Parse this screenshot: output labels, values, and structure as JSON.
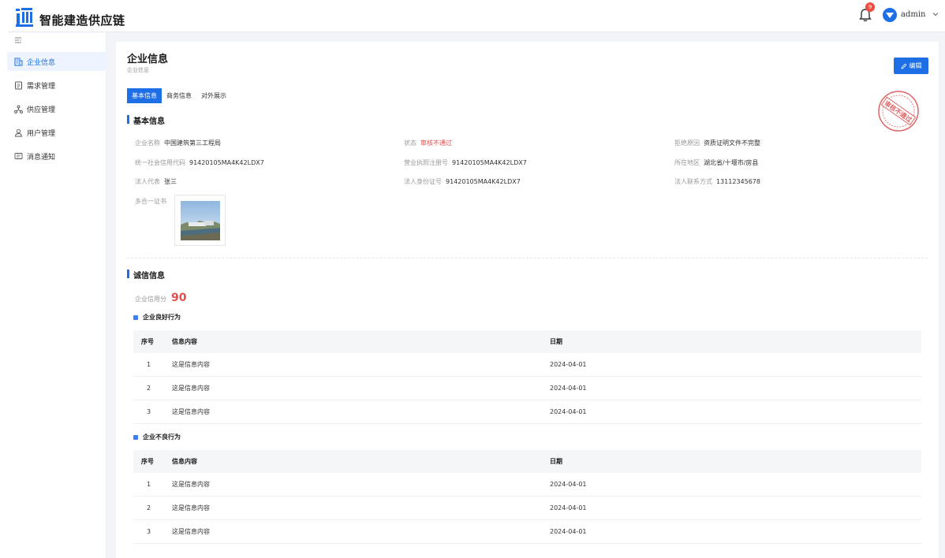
{
  "header": {
    "app_title": "智能建造供应链",
    "notification_count": "9",
    "user_name": "admin"
  },
  "sidebar": {
    "items": [
      {
        "label": "企业信息",
        "icon": "building-icon",
        "active": true
      },
      {
        "label": "需求管理",
        "icon": "document-icon",
        "active": false
      },
      {
        "label": "供应管理",
        "icon": "network-icon",
        "active": false
      },
      {
        "label": "用户管理",
        "icon": "user-icon",
        "active": false
      },
      {
        "label": "消息通知",
        "icon": "message-icon",
        "active": false
      }
    ]
  },
  "page": {
    "title": "企业信息",
    "breadcrumb": "企业信息",
    "edit_label": "编辑",
    "tabs": [
      "基本信息",
      "商务信息",
      "对外展示"
    ],
    "stamp_text": "审核不通过"
  },
  "basic": {
    "section_title": "基本信息",
    "company_name_label": "企业名称",
    "company_name": "中国建筑第三工程局",
    "status_label": "状态",
    "status": "审核不通过",
    "reject_label": "拒绝原因",
    "reject_reason": "资质证明文件不完整",
    "credit_code_label": "统一社会信用代码",
    "credit_code": "91420105MA4K42LDX7",
    "license_label": "营业执照注册号",
    "license_no": "91420105MA4K42LDX7",
    "region_label": "所在地区",
    "region": "湖北省/十堰市/房县",
    "legal_rep_label": "法人代表",
    "legal_rep": "张三",
    "legal_id_label": "法人身份证号",
    "legal_id": "91420105MA4K42LDX7",
    "legal_phone_label": "法人联系方式",
    "legal_phone": "13112345678",
    "cert_label": "多合一证书"
  },
  "credit": {
    "section_title": "诚信信息",
    "score_label": "企业信用分",
    "score": "90",
    "good": {
      "title": "企业良好行为",
      "headers": [
        "序号",
        "信息内容",
        "日期"
      ],
      "rows": [
        [
          "1",
          "这是信息内容",
          "2024-04-01"
        ],
        [
          "2",
          "这是信息内容",
          "2024-04-01"
        ],
        [
          "3",
          "这是信息内容",
          "2024-04-01"
        ]
      ]
    },
    "bad": {
      "title": "企业不良行为",
      "headers": [
        "序号",
        "信息内容",
        "日期"
      ],
      "rows": [
        [
          "1",
          "这是信息内容",
          "2024-04-01"
        ],
        [
          "2",
          "这是信息内容",
          "2024-04-01"
        ],
        [
          "3",
          "这是信息内容",
          "2024-04-01"
        ]
      ]
    }
  },
  "colors": {
    "primary": "#1e6fe6",
    "danger": "#e34d4d",
    "badge": "#ef4b3f"
  }
}
